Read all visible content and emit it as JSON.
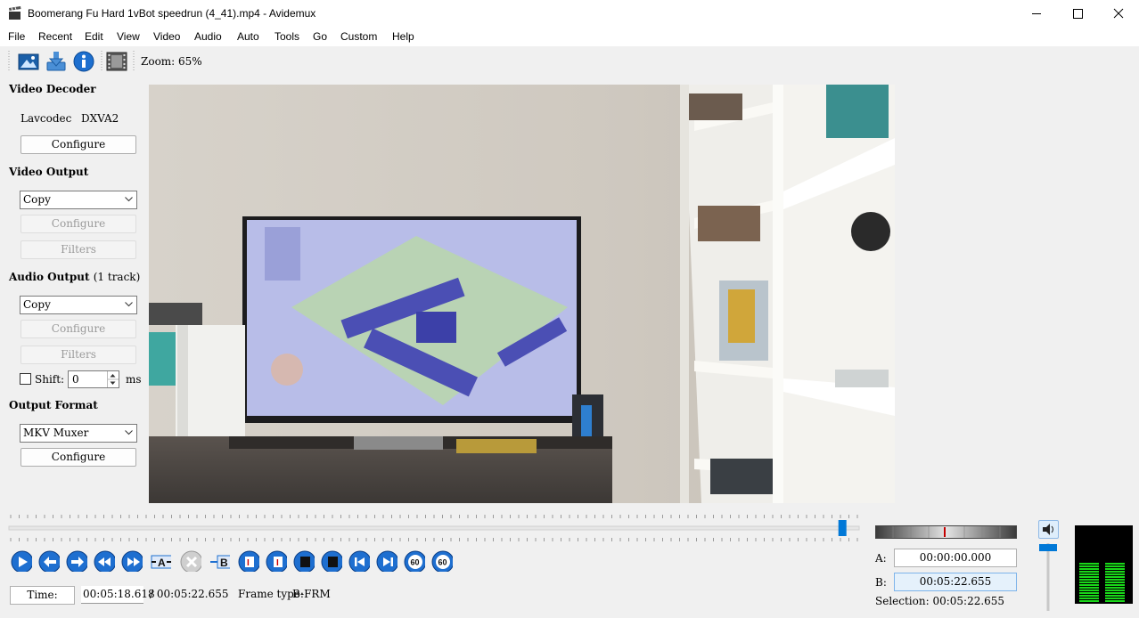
{
  "window": {
    "title": "Boomerang Fu Hard 1vBot speedrun (4_41).mp4 - Avidemux"
  },
  "menu": [
    "File",
    "Recent",
    "Edit",
    "View",
    "Video",
    "Audio",
    "Auto",
    "Tools",
    "Go",
    "Custom",
    "Help"
  ],
  "toolbar": {
    "zoom": "Zoom: 65%"
  },
  "video_decoder": {
    "header": "Video Decoder",
    "decoder": "Lavcodec",
    "accel": "DXVA2",
    "configure": "Configure"
  },
  "video_output": {
    "header": "Video Output",
    "codec": "Copy",
    "configure": "Configure",
    "filters": "Filters"
  },
  "audio_output": {
    "header": "Audio Output",
    "tracks": "(1 track)",
    "codec": "Copy",
    "configure": "Configure",
    "filters": "Filters",
    "shift_label": "Shift:",
    "shift_value": "0",
    "shift_unit": "ms"
  },
  "output_format": {
    "header": "Output Format",
    "muxer": "MKV Muxer",
    "configure": "Configure"
  },
  "timeline": {
    "position": 0.9803
  },
  "time": {
    "label": "Time:",
    "current": "00:05:18.618",
    "total": "/ 00:05:22.655",
    "frame_type_label": "Frame type:",
    "frame_type": "B-FRM"
  },
  "selection": {
    "a_label": "A:",
    "a_value": "00:00:00.000",
    "b_label": "B:",
    "b_value": "00:05:22.655",
    "summary": "Selection: 00:05:22.655"
  },
  "colors": {
    "accent": "#0078d7",
    "meter_green": "#19d819"
  }
}
